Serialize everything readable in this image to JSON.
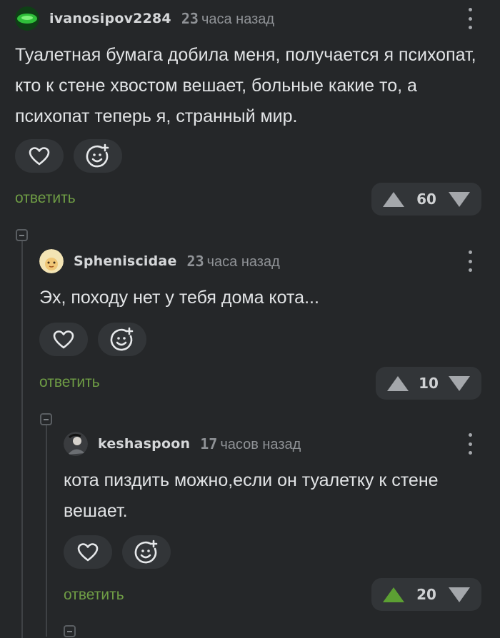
{
  "colors": {
    "background": "#252729",
    "reply_link": "#6f9d45",
    "upvote_active": "#5ca033",
    "button_bg": "#323538"
  },
  "comments": [
    {
      "username": "ivanosipov2284",
      "time_num": "23",
      "time_text": "часа назад",
      "text": "Туалетная бумага добила меня, получается я психопат, кто к стене хвостом вешает, больные какие то, а психопат теперь я, странный мир.",
      "reply_label": "ответить",
      "rating": "60",
      "upvoted": false
    },
    {
      "username": "Spheniscidae",
      "time_num": "23",
      "time_text": "часа назад",
      "text": "Эх, походу нет у тебя дома кота...",
      "reply_label": "ответить",
      "rating": "10",
      "upvoted": false
    },
    {
      "username": "keshaspoon",
      "time_num": "17",
      "time_text": "часов назад",
      "text": "кота пиздить можно,если он туалетку к стене вешает.",
      "reply_label": "ответить",
      "rating": "20",
      "upvoted": true
    }
  ],
  "icons": {
    "like": "heart-icon",
    "react": "emoji-add-icon",
    "more": "more-vertical-icon",
    "upvote": "arrow-up-icon",
    "downvote": "arrow-down-icon",
    "collapse": "collapse-minus-icon"
  }
}
